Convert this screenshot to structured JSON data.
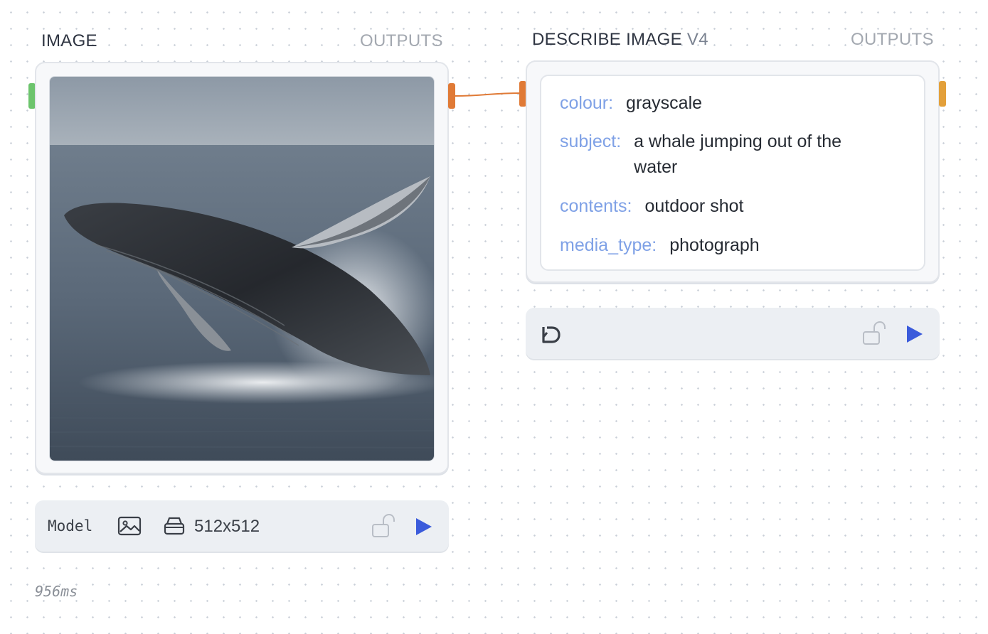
{
  "image_node": {
    "title": "IMAGE",
    "outputs_label": "OUTPUTS",
    "image_alt": "a whale jumping out of the water",
    "toolbar": {
      "model_label": "Model",
      "resolution": "512x512"
    },
    "timing": "956ms"
  },
  "describe_node": {
    "title": "DESCRIBE IMAGE",
    "version": "V4",
    "outputs_label": "OUTPUTS",
    "fields": [
      {
        "key": "colour:",
        "value": "grayscale"
      },
      {
        "key": "subject:",
        "value": "a whale jumping out of the water"
      },
      {
        "key": "contents:",
        "value": "outdoor shot"
      },
      {
        "key": "media_type:",
        "value": "photograph"
      }
    ]
  },
  "colors": {
    "input_handle": "#6cc46c",
    "output_handle": "#e07a36",
    "describe_output_handle": "#e3a03a",
    "edge": "#e07a36",
    "play": "#3b5bdb",
    "key_text": "#7fa1e6"
  },
  "icons": {
    "image": "image-icon",
    "storage": "storage-icon",
    "lock": "unlock-icon",
    "play": "play-icon",
    "reset": "reset-icon"
  }
}
